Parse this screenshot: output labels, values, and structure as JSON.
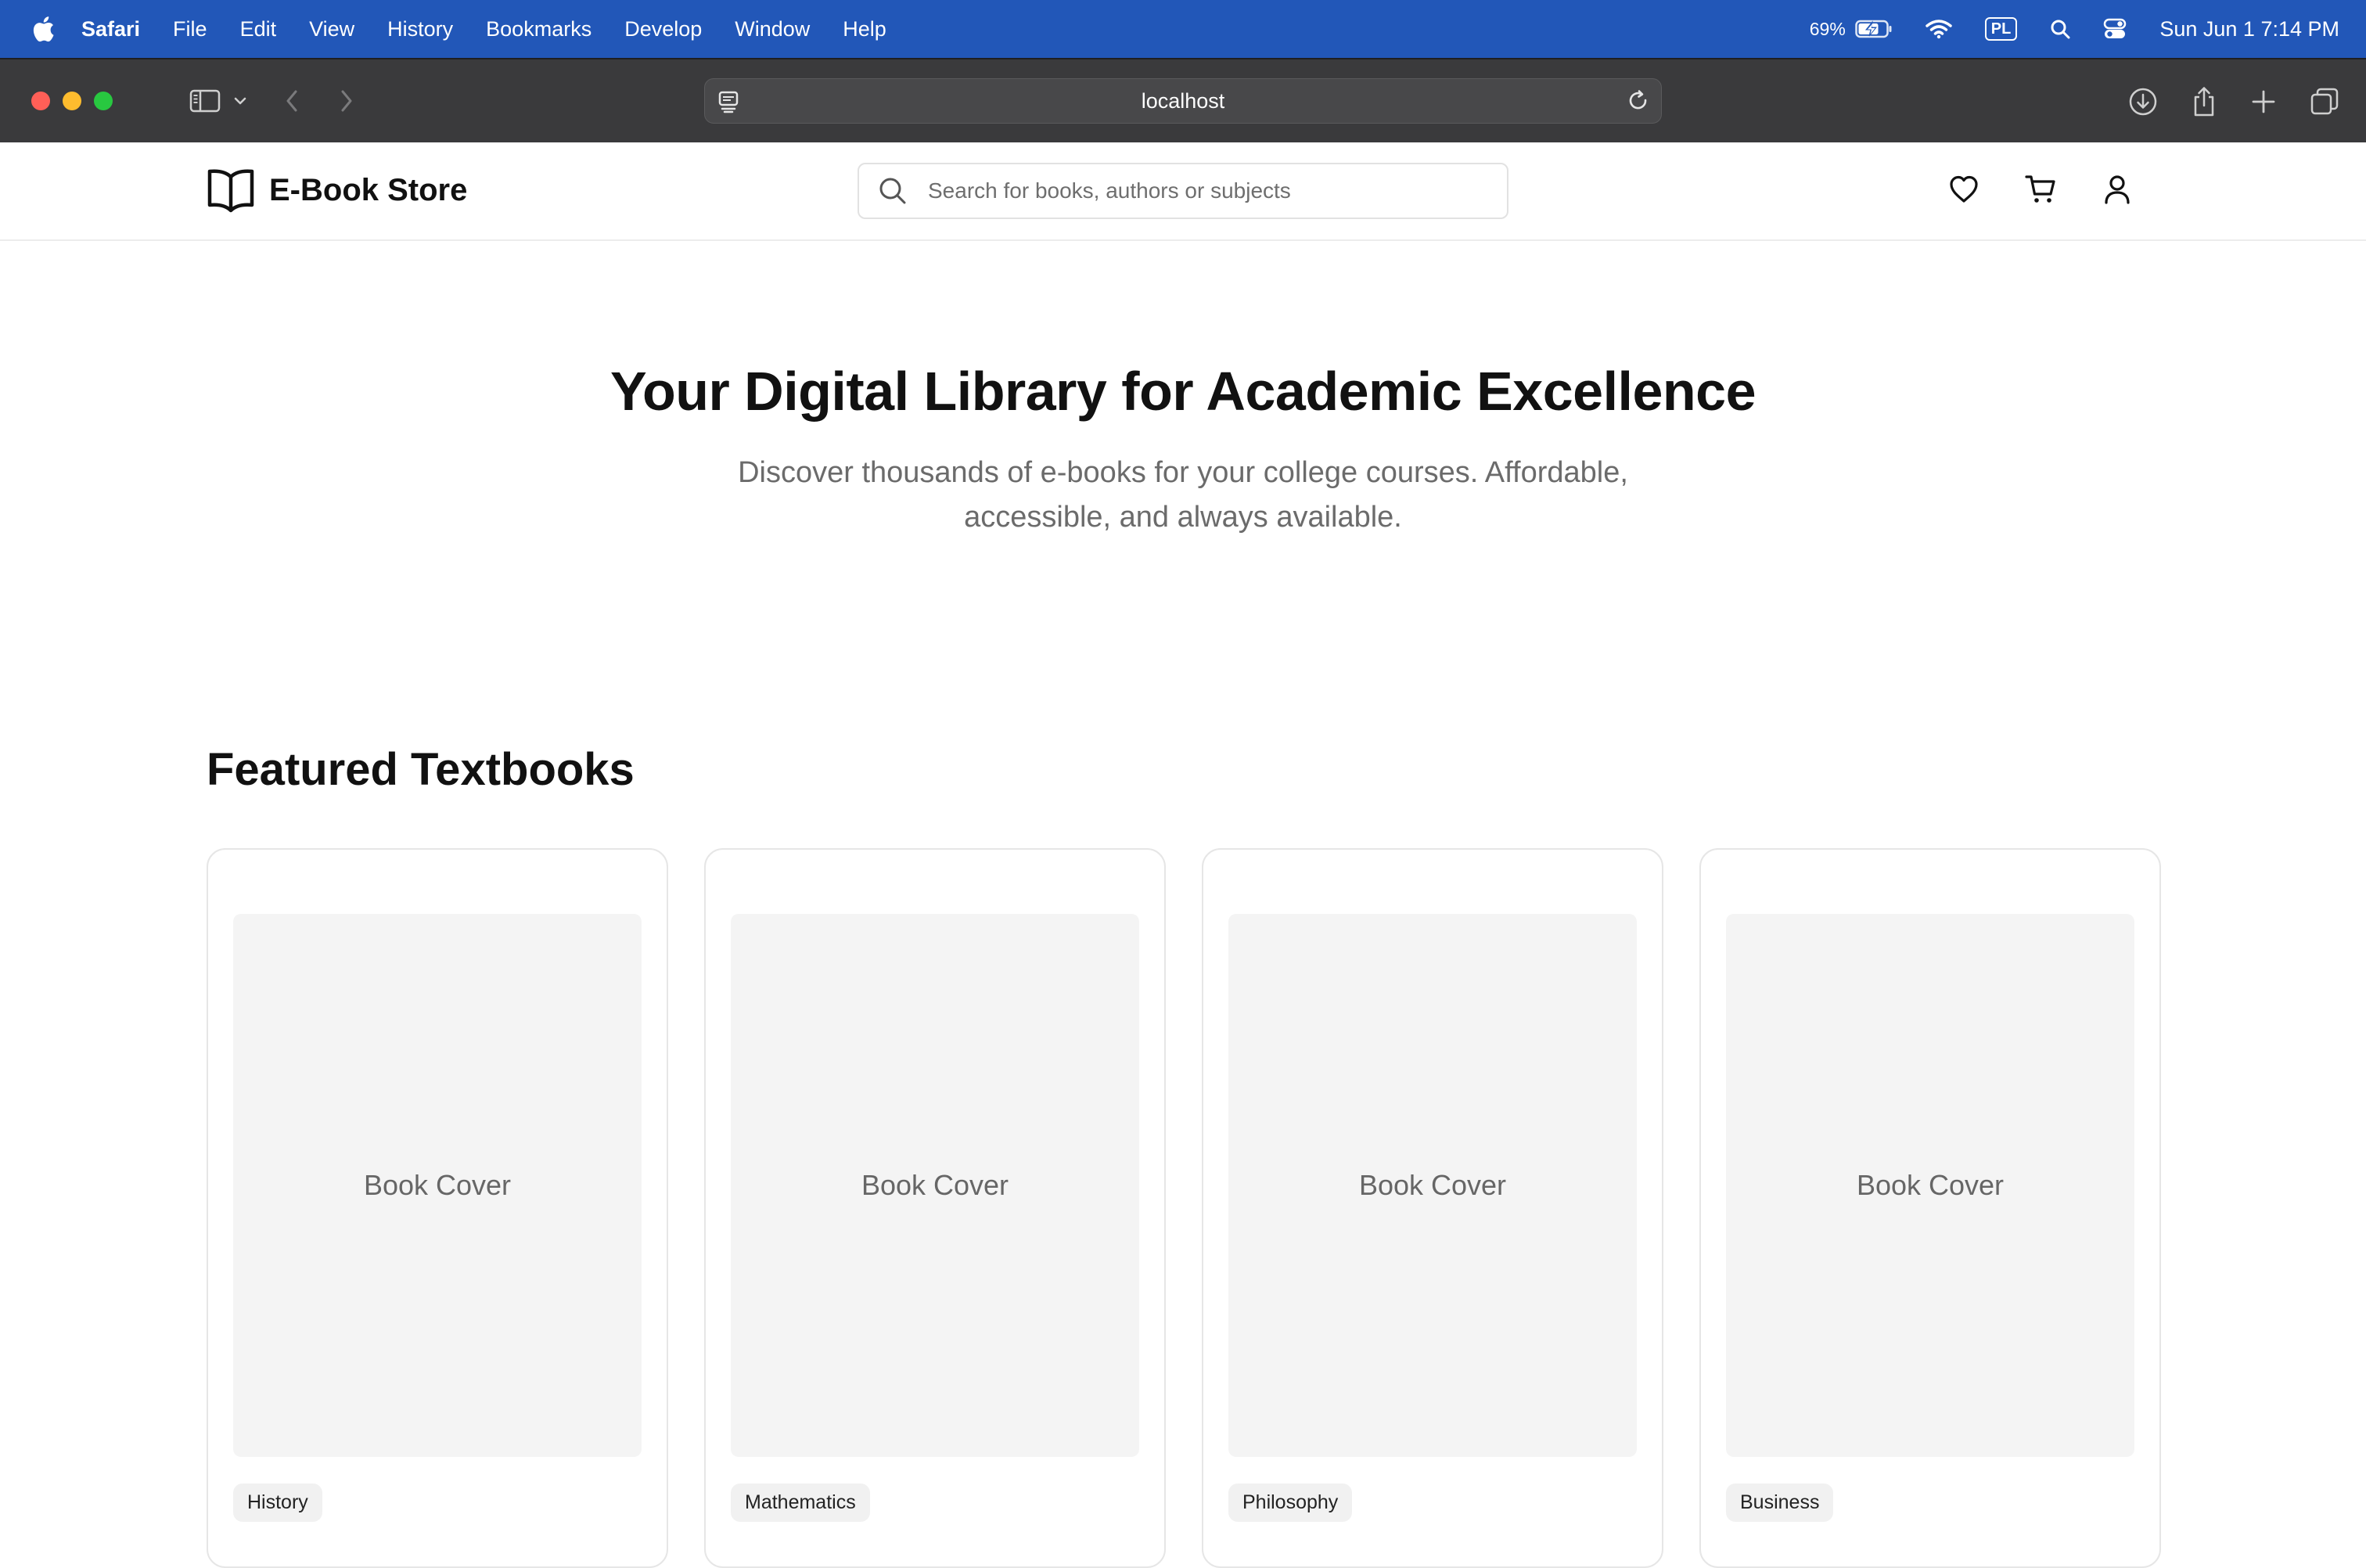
{
  "menubar": {
    "app_name": "Safari",
    "items": [
      "File",
      "Edit",
      "View",
      "History",
      "Bookmarks",
      "Develop",
      "Window",
      "Help"
    ],
    "battery_percent": "69%",
    "input_source": "PL",
    "clock": "Sun Jun 1  7:14 PM"
  },
  "browser": {
    "url": "localhost"
  },
  "header": {
    "logo_text": "E-Book Store",
    "search_placeholder": "Search for books, authors or subjects"
  },
  "hero": {
    "title": "Your Digital Library for Academic Excellence",
    "subtitle": "Discover thousands of e-books for your college courses. Affordable, accessible, and always available."
  },
  "featured": {
    "title": "Featured Textbooks",
    "books": [
      {
        "cover_label": "Book Cover",
        "category": "History"
      },
      {
        "cover_label": "Book Cover",
        "category": "Mathematics"
      },
      {
        "cover_label": "Book Cover",
        "category": "Philosophy"
      },
      {
        "cover_label": "Book Cover",
        "category": "Business"
      }
    ]
  },
  "colors": {
    "menubar_bg": "#2257b8",
    "toolbar_bg": "#3a3a3c",
    "cover_bg": "#f4f4f4"
  }
}
